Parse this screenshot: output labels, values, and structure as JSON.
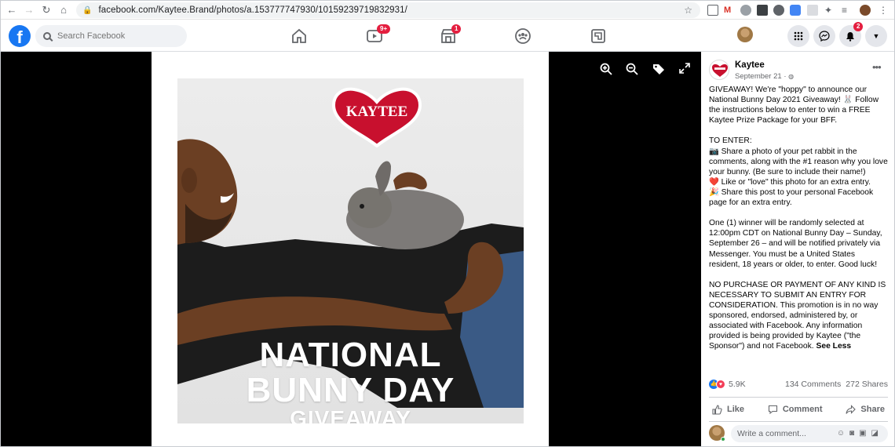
{
  "browser": {
    "url": "facebook.com/Kaytee.Brand/photos/a.153777747930/10159239719832931/"
  },
  "header": {
    "logo": "f",
    "search_placeholder": "Search Facebook",
    "watch_badge": "9+",
    "marketplace_badge": "1",
    "notifications_badge": "2"
  },
  "photo": {
    "brand": "KAYTEE",
    "line1": "NATIONAL",
    "line2": "BUNNY DAY",
    "line3": "GIVEAWAY"
  },
  "post": {
    "author": "Kaytee",
    "date": "September 21 · ",
    "text_main": "GIVEAWAY! We're \"hoppy\" to announce our National Bunny Day 2021 Giveaway! 🐰 Follow the instructions below to enter to win a FREE Kaytee Prize Package for your BFF.\n\nTO ENTER:\n📷 Share a photo of your pet rabbit in the comments, along with the #1 reason why you love your bunny. (Be sure to include their name!)\n❤️ Like or \"love\" this photo for an extra entry.\n🎉 Share this post to your personal Facebook page for an extra entry.\n\nOne (1) winner will be randomly selected at 12:00pm CDT on National Bunny Day – Sunday, September 26 – and will be notified privately via Messenger. You must be a United States resident, 18 years or older, to enter. Good luck!\n\nNO PURCHASE OR PAYMENT OF ANY KIND IS NECESSARY TO SUBMIT AN ENTRY FOR CONSIDERATION. This promotion is in no way sponsored, endorsed, administered by, or associated with Facebook. Any information provided is being provided by Kaytee (\"the Sponsor\") and not Facebook. ",
    "see_less": "See Less",
    "reactions": "5.9K",
    "comments": "134 Comments",
    "shares": "272 Shares",
    "like_label": "Like",
    "comment_label": "Comment",
    "share_label": "Share",
    "comment_placeholder": "Write a comment..."
  },
  "colors": {
    "fb_blue": "#1877f2",
    "badge_red": "#e41e3f",
    "kaytee_red": "#c8102e"
  }
}
